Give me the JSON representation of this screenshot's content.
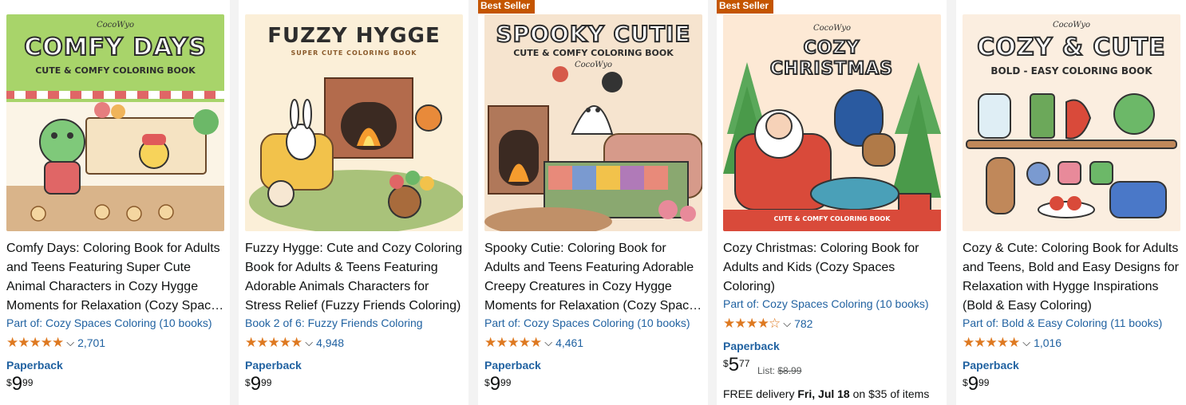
{
  "products": [
    {
      "cover": {
        "title": "COMFY DAYS",
        "subtitle": "CUTE & COMFY COLORING BOOK",
        "brand": "CocoWyo"
      },
      "title": "Comfy Days: Coloring Book for Adults and Teens Featuring Super Cute Animal Characters in Cozy Hygge Moments for Relaxation (Cozy Spaces Coloring)",
      "series": "Part of: Cozy Spaces Coloring (10 books)",
      "stars": "★★★★★",
      "rating_value": 4.8,
      "rating_count": "2,701",
      "format": "Paperback",
      "price": {
        "symbol": "$",
        "whole": "9",
        "fraction": "99"
      }
    },
    {
      "cover": {
        "title": "FUZZY HYGGE",
        "subtitle": "SUPER CUTE COLORING BOOK",
        "brand": ""
      },
      "title": "Fuzzy Hygge: Cute and Cozy Coloring Book for Adults & Teens Featuring Adorable Animals Characters for Stress Relief (Fuzzy Friends Coloring)",
      "series": "Book 2 of 6: Fuzzy Friends Coloring",
      "stars": "★★★★★",
      "rating_value": 4.8,
      "rating_count": "4,948",
      "format": "Paperback",
      "price": {
        "symbol": "$",
        "whole": "9",
        "fraction": "99"
      }
    },
    {
      "badge": "Best Seller",
      "cover": {
        "title": "SPOOKY CUTIE",
        "subtitle": "CUTE & COMFY COLORING BOOK",
        "brand": "CocoWyo"
      },
      "title": "Spooky Cutie: Coloring Book for Adults and Teens Featuring Adorable Creepy Creatures in Cozy Hygge Moments for Relaxation (Cozy Spaces Coloring)",
      "series": "Part of: Cozy Spaces Coloring (10 books)",
      "stars": "★★★★★",
      "rating_value": 4.8,
      "rating_count": "4,461",
      "format": "Paperback",
      "price": {
        "symbol": "$",
        "whole": "9",
        "fraction": "99"
      }
    },
    {
      "badge": "Best Seller",
      "cover": {
        "title": "COZY CHRISTMAS",
        "subtitle": "CUTE & COMFY COLORING BOOK",
        "brand": "CocoWyo"
      },
      "title": "Cozy Christmas: Coloring Book for Adults and Kids (Cozy Spaces Coloring)",
      "series": "Part of: Cozy Spaces Coloring (10 books)",
      "stars": "★★★★☆",
      "rating_value": 4.6,
      "rating_count": "782",
      "format": "Paperback",
      "price": {
        "symbol": "$",
        "whole": "5",
        "fraction": "77"
      },
      "list_label": "List:",
      "list_price": "$8.99",
      "delivery_prefix": "FREE delivery",
      "delivery_date": "Fri, Jul 18",
      "delivery_suffix": "on $35 of items"
    },
    {
      "cover": {
        "title": "COZY & CUTE",
        "subtitle": "BOLD - EASY COLORING BOOK",
        "brand": "CocoWyo"
      },
      "title": "Cozy & Cute: Coloring Book for Adults and Teens, Bold and Easy Designs for Relaxation with Hygge Inspirations (Bold & Easy Coloring)",
      "series": "Part of: Bold & Easy Coloring (11 books)",
      "stars": "★★★★★",
      "rating_value": 4.8,
      "rating_count": "1,016",
      "format": "Paperback",
      "price": {
        "symbol": "$",
        "whole": "9",
        "fraction": "99"
      }
    }
  ],
  "colors": {
    "star": "#de7921",
    "link": "#2162a1",
    "badge": "#c45500"
  }
}
